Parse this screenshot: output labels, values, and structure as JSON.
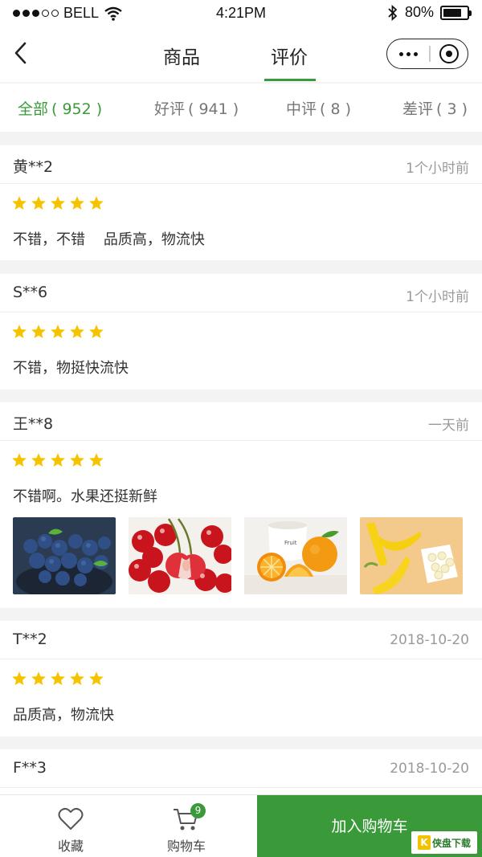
{
  "status_bar": {
    "carrier": "BELL",
    "time": "4:21PM",
    "battery_text": "80%",
    "battery_level": 0.8
  },
  "nav": {
    "tabs": [
      {
        "label": "商品"
      },
      {
        "label": "评价",
        "active": true
      }
    ]
  },
  "filters": [
    {
      "label": "全部",
      "count": "( 952 )",
      "active": true
    },
    {
      "label": "好评",
      "count": "( 941 )"
    },
    {
      "label": "中评",
      "count": "( 8 )"
    },
    {
      "label": "差评",
      "count": "( 3 )"
    }
  ],
  "reviews": [
    {
      "user": "黄**2",
      "time": "1个小时前",
      "stars": 5,
      "text": "不错，不错    品质高，物流快"
    },
    {
      "user": "S**6",
      "time": "1个小时前",
      "stars": 5,
      "text": "不错，物挺快流快"
    },
    {
      "user": "王**8",
      "time": "一天前",
      "stars": 5,
      "text": "不错啊。水果还挺新鲜",
      "photos": [
        "blueberries",
        "cherries",
        "oranges",
        "bananas"
      ]
    },
    {
      "user": "T**2",
      "time": "2018-10-20",
      "stars": 5,
      "text": "品质高，物流快"
    },
    {
      "user": "F**3",
      "time": "2018-10-20"
    }
  ],
  "bottom_bar": {
    "favorite_label": "收藏",
    "cart_label": "购物车",
    "cart_badge": "9",
    "add_to_cart_label": "加入购物车"
  },
  "watermark": {
    "logo": "K",
    "text": "侠盘下载"
  },
  "colors": {
    "accent": "#3a9a3a",
    "star": "#f5c400",
    "muted": "#9a9a9a"
  }
}
